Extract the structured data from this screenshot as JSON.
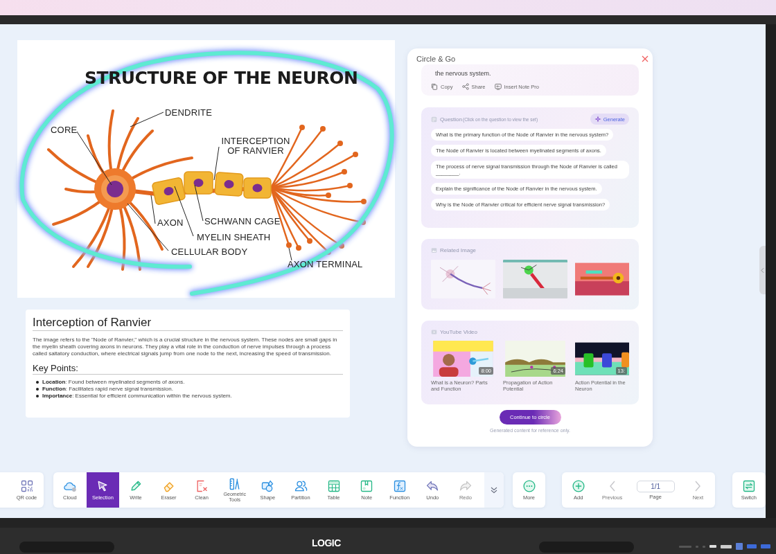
{
  "diagram": {
    "title": "STRUCTURE OF THE NEURON",
    "labels": [
      "DENDRITE",
      "CORE",
      "INTERCEPTION OF RANVIER",
      "AXON",
      "SCHWANN CAGE",
      "MYELIN SHEATH",
      "CELLULAR BODY",
      "AXON TERMINAL"
    ]
  },
  "note_card": {
    "title": "Interception of Ranvier",
    "paragraph": "The image refers to the \"Node of Ranvier,\" which is a crucial structure in the nervous system. These nodes are small gaps in the myelin sheath covering axons in neurons. They play a vital role in the conduction of nerve impulses through a process called saltatory conduction, where electrical signals jump from one node to the next, increasing the speed of transmission.",
    "subtitle": "Key Points:",
    "points": [
      {
        "term": "Location",
        "text": ": Found between myelinated segments of axons."
      },
      {
        "term": "Function",
        "text": ": Facilitates rapid nerve signal transmission."
      },
      {
        "term": "Importance",
        "text": ": Essential for efficient communication within the nervous system."
      }
    ]
  },
  "panel": {
    "title": "Circle & Go",
    "answer_tail": "the nervous system.",
    "actions": [
      {
        "label": "Copy"
      },
      {
        "label": "Share"
      },
      {
        "label": "Insert Note Pro"
      }
    ],
    "questions": {
      "title": "Question",
      "hint": "(Click on the question to view the set)",
      "generate": "Generate",
      "items": [
        "What is the primary function of the Node of Ranvier in the nervous system?",
        "The Node of Ranvier is located between myelinated segments of axons.",
        "The process of nerve signal transmission through the Node of Ranvier is called ________.",
        "Explain the significance of the Node of Ranvier in the nervous system.",
        "Why is the Node of Ranvier critical for efficient nerve signal transmission?"
      ]
    },
    "related_images": {
      "title": "Related Image"
    },
    "videos": {
      "title": "YouTube Video",
      "items": [
        {
          "duration": "8:00",
          "title": "What is a Neuron? Parts and Function"
        },
        {
          "duration": "6:24",
          "title": "Propagation of Action Potential"
        },
        {
          "duration": "13:",
          "title": "Action Potential in the Neuron"
        }
      ]
    },
    "continue_button": "Continue to circle",
    "disclaimer": "Generated content for reference only."
  },
  "toolbar": {
    "left_tools": [
      {
        "label": "QR code"
      }
    ],
    "tools": [
      {
        "label": "Cloud",
        "selected": false,
        "disabled": false
      },
      {
        "label": "Selection",
        "selected": true,
        "disabled": false
      },
      {
        "label": "Write",
        "selected": false,
        "disabled": false
      },
      {
        "label": "Eraser",
        "selected": false,
        "disabled": false
      },
      {
        "label": "Clean",
        "selected": false,
        "disabled": false
      },
      {
        "label": "Geometric Tools",
        "selected": false,
        "disabled": false
      },
      {
        "label": "Shape",
        "selected": false,
        "disabled": false
      },
      {
        "label": "Partition",
        "selected": false,
        "disabled": false
      },
      {
        "label": "Table",
        "selected": false,
        "disabled": false
      },
      {
        "label": "Note",
        "selected": false,
        "disabled": false
      },
      {
        "label": "Function",
        "selected": false,
        "disabled": false
      },
      {
        "label": "Undo",
        "selected": false,
        "disabled": false
      },
      {
        "label": "Redo",
        "selected": false,
        "disabled": true
      }
    ],
    "more": "More",
    "pages": {
      "add": "Add",
      "previous": {
        "label": "Previous",
        "disabled": true
      },
      "page_value": "1/1",
      "page_label": "Page",
      "next": {
        "label": "Next",
        "disabled": true
      }
    },
    "switch": "Switch"
  },
  "bezel": {
    "brand": "LOGIC"
  }
}
